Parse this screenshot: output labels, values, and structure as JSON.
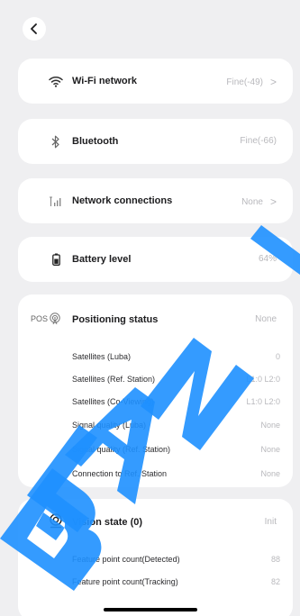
{
  "nav": {
    "back_icon": "chevron-left-icon"
  },
  "items": {
    "wifi": {
      "icon": "wifi-icon",
      "label": "Wi-Fi network",
      "value": "Fine(-49)",
      "chevron": ">"
    },
    "bluetooth": {
      "icon": "bluetooth-icon",
      "label": "Bluetooth",
      "value": "Fine(-66)"
    },
    "network": {
      "icon": "signal-bars-icon",
      "label": "Network connections",
      "value": "None",
      "chevron": ">"
    },
    "battery": {
      "icon": "battery-icon",
      "label": "Battery level",
      "value": "64%"
    }
  },
  "positioning": {
    "icon_prefix": "POS",
    "icon": "satellite-icon",
    "label": "Positioning status",
    "value": "None",
    "rows": [
      {
        "label": "Satellites (Luba)",
        "value": "0"
      },
      {
        "label": "Satellites (Ref. Station)",
        "value": "L1:0 L2:0"
      },
      {
        "label": "Satellites (Co-Viewing)",
        "value": "L1:0 L2:0"
      },
      {
        "label": "Signal quality (Luba)",
        "value": "None"
      },
      {
        "label": "Signal quality (Ref. Station)",
        "value": "None"
      },
      {
        "label": "Connection to Ref. Station",
        "value": "None"
      }
    ]
  },
  "vision": {
    "icon": "camera-lens-icon",
    "label": "Vision state (0)",
    "value": "Init",
    "rows": [
      {
        "label": "Feature point count(Detected)",
        "value": "88"
      },
      {
        "label": "Feature point count(Tracking)",
        "value": "82"
      }
    ]
  },
  "watermark": {
    "text": "BLAN",
    "color": "#1e90ff"
  }
}
